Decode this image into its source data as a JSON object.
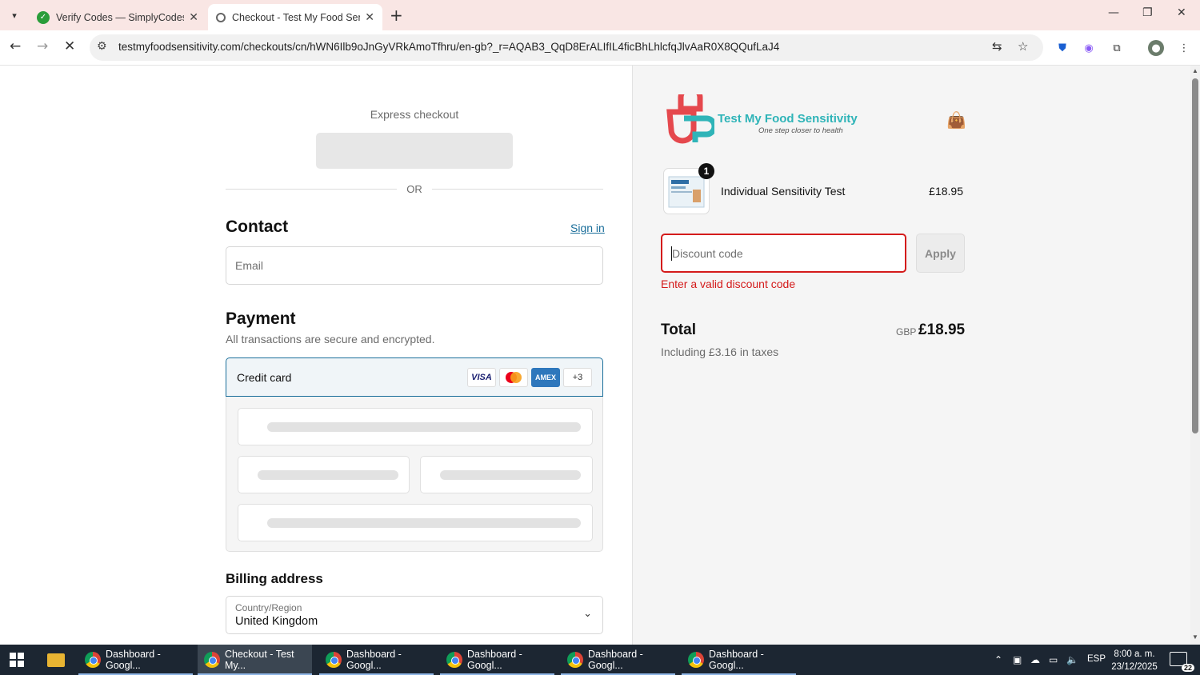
{
  "browser": {
    "tabs": [
      {
        "title": "Verify Codes — SimplyCodes",
        "icon": "simplycodes-favicon"
      },
      {
        "title": "Checkout - Test My Food Sensit",
        "icon": "loading-favicon"
      }
    ],
    "url": "testmyfoodsensitivity.com/checkouts/cn/hWN6Ilb9oJnGyVRkAmoTfhru/en-gb?_r=AQAB3_QqD8ErALIfIL4ficBhLhlcfqJlvAaR0X8QQufLaJ4"
  },
  "checkout": {
    "express_title": "Express checkout",
    "or_text": "OR",
    "contact_heading": "Contact",
    "sign_in": "Sign in",
    "email_placeholder": "Email",
    "payment_heading": "Payment",
    "payment_subtext": "All transactions are secure and encrypted.",
    "credit_card_label": "Credit card",
    "card_badges": [
      "VISA",
      "",
      "AMEX",
      "+3"
    ],
    "billing_heading": "Billing address",
    "country_label": "Country/Region",
    "country_value": "United Kingdom"
  },
  "summary": {
    "logo_text": "Test My Food Sensitivity",
    "logo_tagline": "One step closer to health",
    "item": {
      "quantity": "1",
      "name": "Individual Sensitivity Test",
      "price": "£18.95"
    },
    "discount_placeholder": "Discount code",
    "apply_label": "Apply",
    "discount_error": "Enter a valid discount code",
    "total_label": "Total",
    "currency": "GBP",
    "total_value": "£18.95",
    "taxes_note": "Including £3.16 in taxes"
  },
  "taskbar": {
    "items": [
      {
        "label": "Dashboard - Googl..."
      },
      {
        "label": "Checkout - Test My..."
      },
      {
        "label": "Dashboard - Googl..."
      },
      {
        "label": "Dashboard - Googl..."
      },
      {
        "label": "Dashboard - Googl..."
      },
      {
        "label": "Dashboard - Googl..."
      }
    ],
    "language": "ESP",
    "time": "8:00 a. m.",
    "date": "23/12/2025",
    "notification_count": "22"
  },
  "colors": {
    "accent": "#1a6e9a",
    "error": "#d41b1b",
    "logo_teal": "#2fb4b8",
    "logo_red": "#e5484d"
  }
}
